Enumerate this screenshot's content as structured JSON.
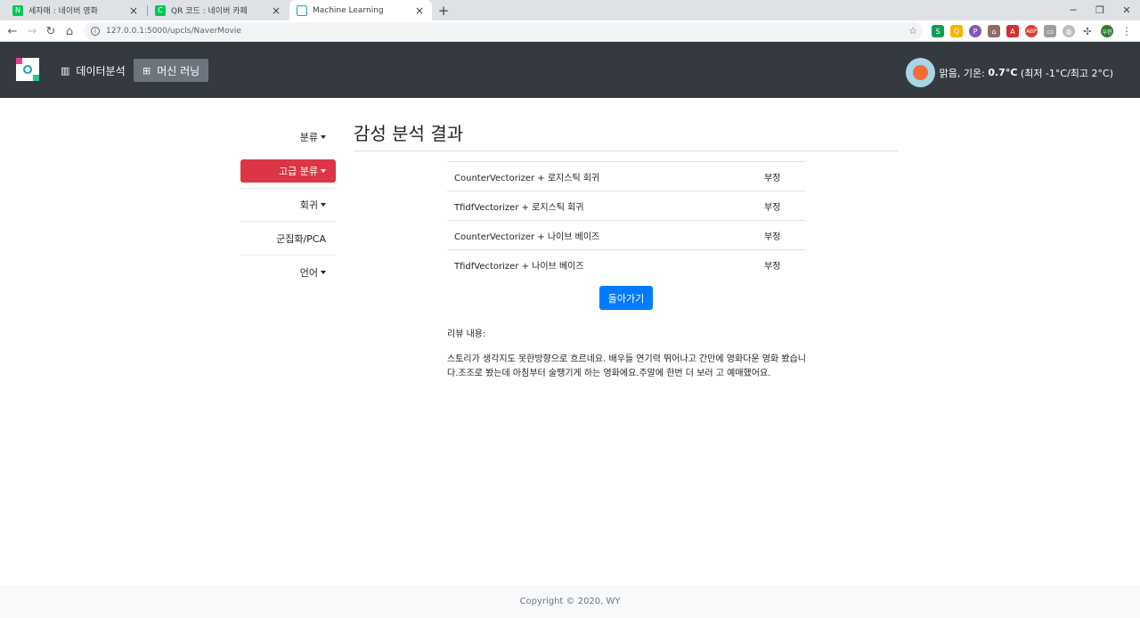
{
  "browser": {
    "tabs": [
      {
        "title": "세자매 : 네이버 영화",
        "icon": "naver-icon"
      },
      {
        "title": "QR 코드 : 네이버 카페",
        "icon": "naver-cafe-icon"
      },
      {
        "title": "Machine Learning",
        "icon": "app-icon"
      }
    ],
    "url": "127.0.0.1:5000/upcls/NaverMovie",
    "profile_label": "우현"
  },
  "navbar": {
    "links": [
      {
        "label": "데이터분석",
        "icon": "chart-icon"
      },
      {
        "label": "머신 러닝",
        "icon": "sitemap-icon"
      }
    ],
    "weather": {
      "desc": "맑음, 기온:",
      "temp": "0.7°C",
      "range": "(최저 -1°C/최고 2°C)"
    }
  },
  "sidebar": {
    "items": [
      {
        "label": "분류",
        "dropdown": true
      },
      {
        "label": "고급 분류",
        "dropdown": true,
        "active": true
      },
      {
        "label": "회귀",
        "dropdown": true
      },
      {
        "label": "군집화/PCA",
        "dropdown": false
      },
      {
        "label": "언어",
        "dropdown": true
      }
    ]
  },
  "main": {
    "title": "감성 분석 결과",
    "results": [
      {
        "model": "CounterVectorizer + 로지스틱 회귀",
        "result": "부정"
      },
      {
        "model": "TfidfVectorizer + 로지스틱 회귀",
        "result": "부정"
      },
      {
        "model": "CounterVectorizer + 나이브 베이즈",
        "result": "부정"
      },
      {
        "model": "TfidfVectorizer + 나이브 베이즈",
        "result": "부정"
      }
    ],
    "back_label": "돌아가기",
    "review_label": "리뷰 내용:",
    "review_text": "스토리가 생각지도 못한방향으로 흐르네요. 배우들 연기력 뛰어나고 간만에 영화다운 영화 봤습니다.조조로 봤는데 아침부터 술땡기게 하는 영화에요.주말에 한번 더 보러 고 예매했어요."
  },
  "footer": {
    "text": "Copyright © 2020, WY"
  },
  "colors": {
    "navbar": "#343a40",
    "active_side": "#dc3545",
    "primary": "#007bff"
  }
}
